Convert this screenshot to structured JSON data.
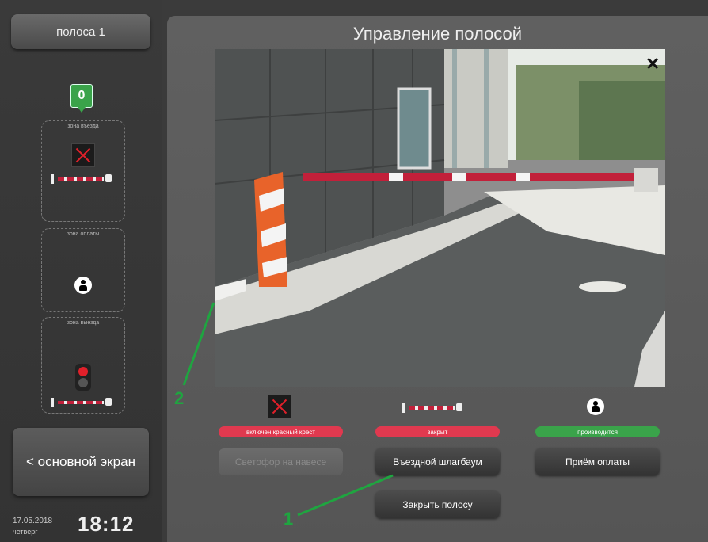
{
  "sidebar": {
    "lane_button": "полоса 1",
    "counter": "0",
    "zones": [
      {
        "label": "зона въезда"
      },
      {
        "label": "зона оплаты"
      },
      {
        "label": "зона выезда"
      }
    ],
    "main_screen_button": "< основной экран",
    "date": "17.05.2018",
    "weekday": "четверг",
    "time": "18:12"
  },
  "panel": {
    "title": "Управление полосой",
    "close_symbol": "✕"
  },
  "statuses": [
    {
      "label": "включен красный крест",
      "color": "#e0394f"
    },
    {
      "label": "закрыт",
      "color": "#e0394f"
    },
    {
      "label": "производится",
      "color": "#3aa34a"
    }
  ],
  "buttons": {
    "canopy_light": "Светофор на навесе",
    "entry_barrier": "Въездной шлагбаум",
    "payment": "Приём оплаты",
    "close_lane": "Закрыть полосу"
  },
  "annotations": {
    "one": "1",
    "two": "2",
    "color": "#1fa540"
  },
  "icons": [
    "red-cross-signal-icon",
    "barrier-icon",
    "cashier-person-icon",
    "traffic-light-icon"
  ]
}
